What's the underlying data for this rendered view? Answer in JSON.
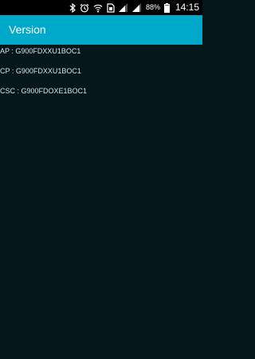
{
  "status_bar": {
    "icons": [
      "bluetooth-icon",
      "alarm-icon",
      "wifi-icon",
      "sim-card-icon",
      "signal-icon",
      "signal-icon",
      "battery-icon"
    ],
    "battery_percent": "88%",
    "time": "14:15"
  },
  "app_bar": {
    "title": "Version"
  },
  "versions": [
    {
      "text": "AP : G900FDXXU1BOC1"
    },
    {
      "text": "CP : G900FDXXU1BOC1"
    },
    {
      "text": "CSC : G900FDOXE1BOC1"
    }
  ],
  "colors": {
    "status_bar_bg": "#000000",
    "app_bar_bg": "#00a9c9",
    "content_bg": "#05171b",
    "text": "#d8e0e2"
  }
}
